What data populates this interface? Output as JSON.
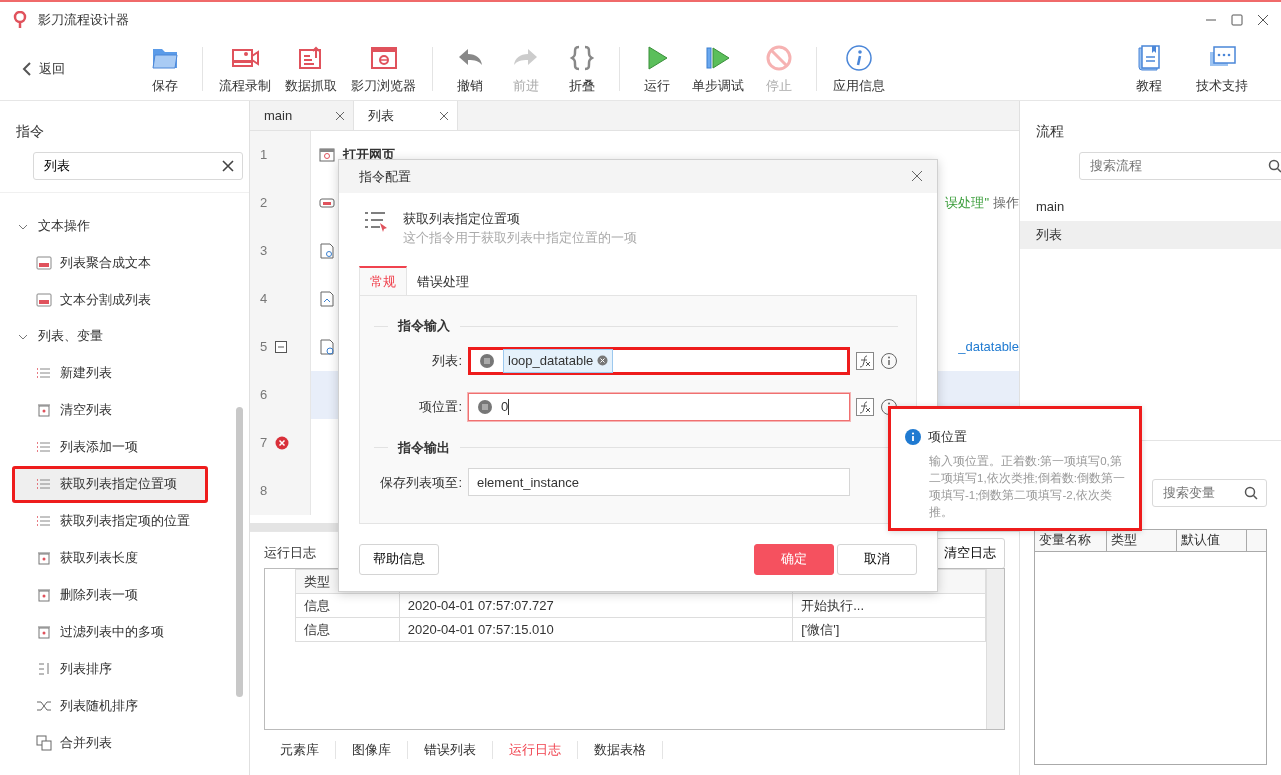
{
  "window": {
    "title": "影刀流程设计器"
  },
  "toolbar": {
    "back": "返回",
    "groups": [
      [
        {
          "label": "保存",
          "disabled": false
        }
      ],
      [
        {
          "label": "流程录制",
          "disabled": false
        },
        {
          "label": "数据抓取",
          "disabled": false
        },
        {
          "label": "影刀浏览器",
          "disabled": false
        }
      ],
      [
        {
          "label": "撤销",
          "disabled": false
        },
        {
          "label": "前进",
          "disabled": true
        },
        {
          "label": "折叠",
          "disabled": false
        }
      ],
      [
        {
          "label": "运行",
          "disabled": false
        },
        {
          "label": "单步调试",
          "disabled": false
        },
        {
          "label": "停止",
          "disabled": true
        }
      ],
      [
        {
          "label": "应用信息",
          "disabled": false
        }
      ]
    ],
    "right": [
      {
        "label": "教程"
      },
      {
        "label": "技术支持"
      }
    ]
  },
  "sidebar": {
    "title": "指令",
    "search": {
      "value": "列表"
    },
    "groups": [
      {
        "label": "文本操作",
        "expanded": true,
        "children": [
          {
            "label": "列表聚合成文本",
            "selected": false,
            "outlined": false
          },
          {
            "label": "文本分割成列表",
            "selected": false,
            "outlined": false
          }
        ]
      },
      {
        "label": "列表、变量",
        "expanded": true,
        "children": [
          {
            "label": "新建列表",
            "selected": false,
            "outlined": false
          },
          {
            "label": "清空列表",
            "selected": false,
            "outlined": false
          },
          {
            "label": "列表添加一项",
            "selected": false,
            "outlined": false
          },
          {
            "label": "获取列表指定位置项",
            "selected": true,
            "outlined": true
          },
          {
            "label": "获取列表指定项的位置",
            "selected": false,
            "outlined": false
          },
          {
            "label": "获取列表长度",
            "selected": false,
            "outlined": false
          },
          {
            "label": "删除列表一项",
            "selected": false,
            "outlined": false
          },
          {
            "label": "过滤列表中的多项",
            "selected": false,
            "outlined": false
          },
          {
            "label": "列表排序",
            "selected": false,
            "outlined": false
          },
          {
            "label": "列表随机排序",
            "selected": false,
            "outlined": false
          },
          {
            "label": "合并列表",
            "selected": false,
            "outlined": false
          }
        ]
      }
    ]
  },
  "editor": {
    "tabs": [
      {
        "label": "main",
        "selected": false
      },
      {
        "label": "列表",
        "selected": true
      }
    ],
    "lines": [
      {
        "number": "1",
        "text": "打开网页",
        "icon": true,
        "selected": false,
        "error": false,
        "collapsible": false
      },
      {
        "number": "2",
        "icon": true,
        "selected": false,
        "error": false,
        "collapsible": false,
        "fragments": [
          {
            "text": "误处理\"",
            "color": "#3a9d3a"
          },
          {
            "text": "操作",
            "color": "#666666"
          }
        ]
      },
      {
        "number": "3",
        "icon": true,
        "selected": false,
        "error": false,
        "collapsible": false
      },
      {
        "number": "4",
        "icon": true,
        "selected": false,
        "error": false,
        "collapsible": false
      },
      {
        "number": "5",
        "icon": true,
        "selected": false,
        "error": false,
        "collapsible": true,
        "fragments": [
          {
            "text": "_datatable",
            "color": "#1f7ad1"
          }
        ]
      },
      {
        "number": "6",
        "icon": false,
        "selected": true,
        "error": false,
        "collapsible": false
      },
      {
        "number": "7",
        "icon": false,
        "selected": false,
        "error": true,
        "collapsible": false
      },
      {
        "number": "8",
        "icon": false,
        "selected": false,
        "error": false,
        "collapsible": false
      }
    ]
  },
  "log": {
    "title": "运行日志",
    "clear_button": "清空日志",
    "columns": [
      "类型"
    ],
    "rows": [
      [
        "信息",
        "2020-04-01 07:57:07.727",
        "开始执行..."
      ],
      [
        "信息",
        "2020-04-01 07:57:15.010",
        "['微信']"
      ]
    ]
  },
  "bottom_tabs": [
    {
      "label": "元素库",
      "selected": false
    },
    {
      "label": "图像库",
      "selected": false
    },
    {
      "label": "错误列表",
      "selected": false
    },
    {
      "label": "运行日志",
      "selected": true
    },
    {
      "label": "数据表格",
      "selected": false
    }
  ],
  "flows": {
    "title": "流程",
    "search": {
      "placeholder": "搜索流程"
    },
    "items": [
      {
        "label": "main",
        "selected": false
      },
      {
        "label": "列表",
        "selected": true
      }
    ]
  },
  "variables": {
    "search": {
      "placeholder": "搜索变量"
    },
    "columns": [
      "变量名称",
      "类型",
      "默认值"
    ]
  },
  "dialog": {
    "title": "指令配置",
    "command": "获取列表指定位置项",
    "description": "这个指令用于获取列表中指定位置的一项",
    "tabs": [
      {
        "label": "常规",
        "selected": true
      },
      {
        "label": "错误处理",
        "selected": false
      }
    ],
    "sections": [
      {
        "title": "指令输入",
        "fields": [
          {
            "label": "列表:",
            "kind": "chip",
            "value": "loop_datatable",
            "focused": false,
            "outlined": true,
            "python": true
          },
          {
            "label": "项位置:",
            "kind": "text",
            "value": "0",
            "focused": true,
            "outlined": false,
            "python": true
          }
        ]
      },
      {
        "title": "指令输出",
        "fields": [
          {
            "label": "保存列表项至:",
            "kind": "text",
            "value": "element_instance",
            "focused": false,
            "outlined": false,
            "python": false
          }
        ]
      }
    ],
    "buttons": [
      {
        "label": "帮助信息",
        "kind": "secondary"
      },
      {
        "label": "确定",
        "kind": "primary"
      },
      {
        "label": "取消",
        "kind": "secondary"
      }
    ]
  },
  "tooltip": {
    "title": "项位置",
    "text": "输入项位置。正着数:第一项填写0,第二项填写1,依次类推;倒着数:倒数第一项填写-1;倒数第二项填写-2,依次类推。",
    "outlined": true
  }
}
